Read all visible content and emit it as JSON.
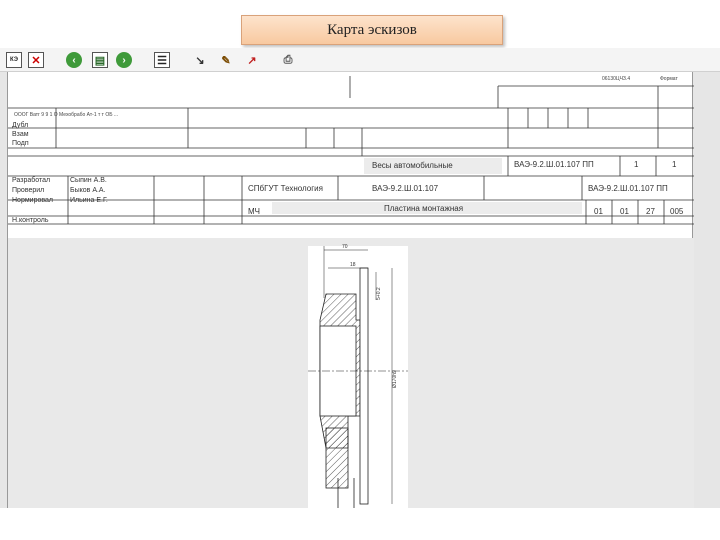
{
  "slide": {
    "title": "Карта эскизов"
  },
  "toolbar": {
    "buttons": [
      {
        "name": "close-sheet-button",
        "label": "КЭ"
      },
      {
        "name": "delete-button",
        "label": "✕"
      },
      {
        "name": "back-button",
        "label": "‹"
      },
      {
        "name": "save-button",
        "label": "▤"
      },
      {
        "name": "forward-button",
        "label": "›"
      },
      {
        "name": "list-button",
        "label": "☰"
      },
      {
        "name": "edit-tool-button",
        "label": "↘"
      },
      {
        "name": "brush-tool-button",
        "label": "✎"
      },
      {
        "name": "arrow-tool-button",
        "label": "↗"
      },
      {
        "name": "print-button",
        "label": "⎙"
      }
    ]
  },
  "stamp": {
    "top_code": "06130ЦЧЗ.4",
    "top_format": "Формат",
    "small_header": "ОООГ Ватг 9 9 1 О Мехобрабо Ат-1 т т ОБ ...",
    "rows_left": [
      "Дубл",
      "Взам",
      "Подп"
    ],
    "doc_type": "Весы автомобильные",
    "doc_code": "ВАЭ-9.2.Ш.01.107 ПП",
    "sheet_no": "1",
    "sheet_total": "1",
    "roles": [
      "Разработал",
      "Проверил",
      "Нормировал",
      "Н.контроль"
    ],
    "people": [
      "Сыпин А.В.",
      "Быков А.А.",
      "Ильина Е.Г."
    ],
    "org": "СПбГУТ Технология",
    "part_code": "ВАЭ-9.2.Ш.01.107",
    "right_code": "ВАЭ-9.2.Ш.01.107 ПП",
    "op_code": "МЧ",
    "op_name": "Пластина монтажная",
    "op_nums": [
      "01",
      "01",
      "27",
      "005"
    ]
  },
  "drawing": {
    "dim_top": "70",
    "dim_small": "18",
    "dim_side": "5+0.2",
    "dim_height": "Ø170h9"
  }
}
